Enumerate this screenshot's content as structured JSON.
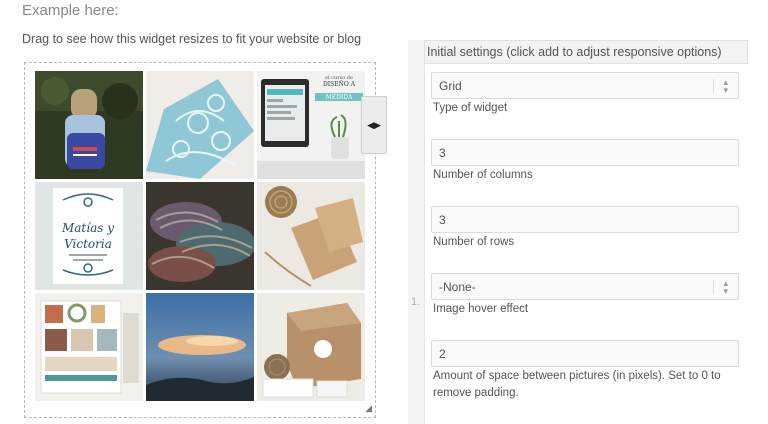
{
  "page": {
    "heading": "Example here:",
    "instructions": "Drag to see how this widget resizes to fit your website or blog"
  },
  "preview": {
    "tiles": [
      {
        "name": "girl-backpack-photo",
        "text": ""
      },
      {
        "name": "blue-lace-fabric-photo",
        "text": ""
      },
      {
        "name": "laptop-design-photo",
        "text": "el curso de\nDISEÑO A\nMEDIDA"
      },
      {
        "name": "wedding-invitation-photo",
        "text": "Matías y\nVictoria"
      },
      {
        "name": "yarn-skeins-photo",
        "text": ""
      },
      {
        "name": "notebooks-twine-photo",
        "text": ""
      },
      {
        "name": "stationery-collage-photo",
        "text": ""
      },
      {
        "name": "sunset-sky-photo",
        "text": ""
      },
      {
        "name": "kraft-box-photo",
        "text": ""
      }
    ]
  },
  "settings": {
    "panel_number": "1.",
    "header": "Initial settings (click add to adjust responsive options)",
    "widget_type": {
      "value": "Grid",
      "label": "Type of widget"
    },
    "columns": {
      "value": "3",
      "label": "Number of columns"
    },
    "rows": {
      "value": "3",
      "label": "Number of rows"
    },
    "hover_effect": {
      "value": "-None-",
      "label": "Image hover effect"
    },
    "spacing": {
      "value": "2",
      "label": "Amount of space between pictures (in pixels). Set to 0 to remove padding."
    }
  },
  "icons": {
    "handle": "left-right-arrows-icon",
    "select": "up-down-caret-icon",
    "resize": "resize-corner-icon"
  }
}
